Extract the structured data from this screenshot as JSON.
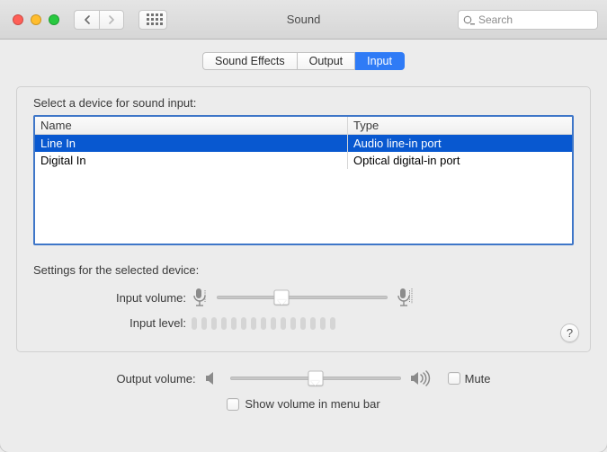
{
  "titlebar": {
    "title": "Sound",
    "search_placeholder": "Search"
  },
  "tabs": [
    {
      "label": "Sound Effects",
      "active": false
    },
    {
      "label": "Output",
      "active": false
    },
    {
      "label": "Input",
      "active": true
    }
  ],
  "panel": {
    "select_label": "Select a device for sound input:",
    "columns": {
      "name": "Name",
      "type": "Type"
    },
    "devices": [
      {
        "name": "Line In",
        "type": "Audio line-in port",
        "selected": true
      },
      {
        "name": "Digital In",
        "type": "Optical digital-in port",
        "selected": false
      }
    ],
    "settings_label": "Settings for the selected device:",
    "input_volume_label": "Input volume:",
    "input_volume_percent": 38,
    "input_level_label": "Input level:",
    "input_level_bars": 15,
    "help_label": "?"
  },
  "output": {
    "label": "Output volume:",
    "percent": 50,
    "mute_label": "Mute",
    "mute_checked": false,
    "menubar_label": "Show volume in menu bar",
    "menubar_checked": false
  }
}
